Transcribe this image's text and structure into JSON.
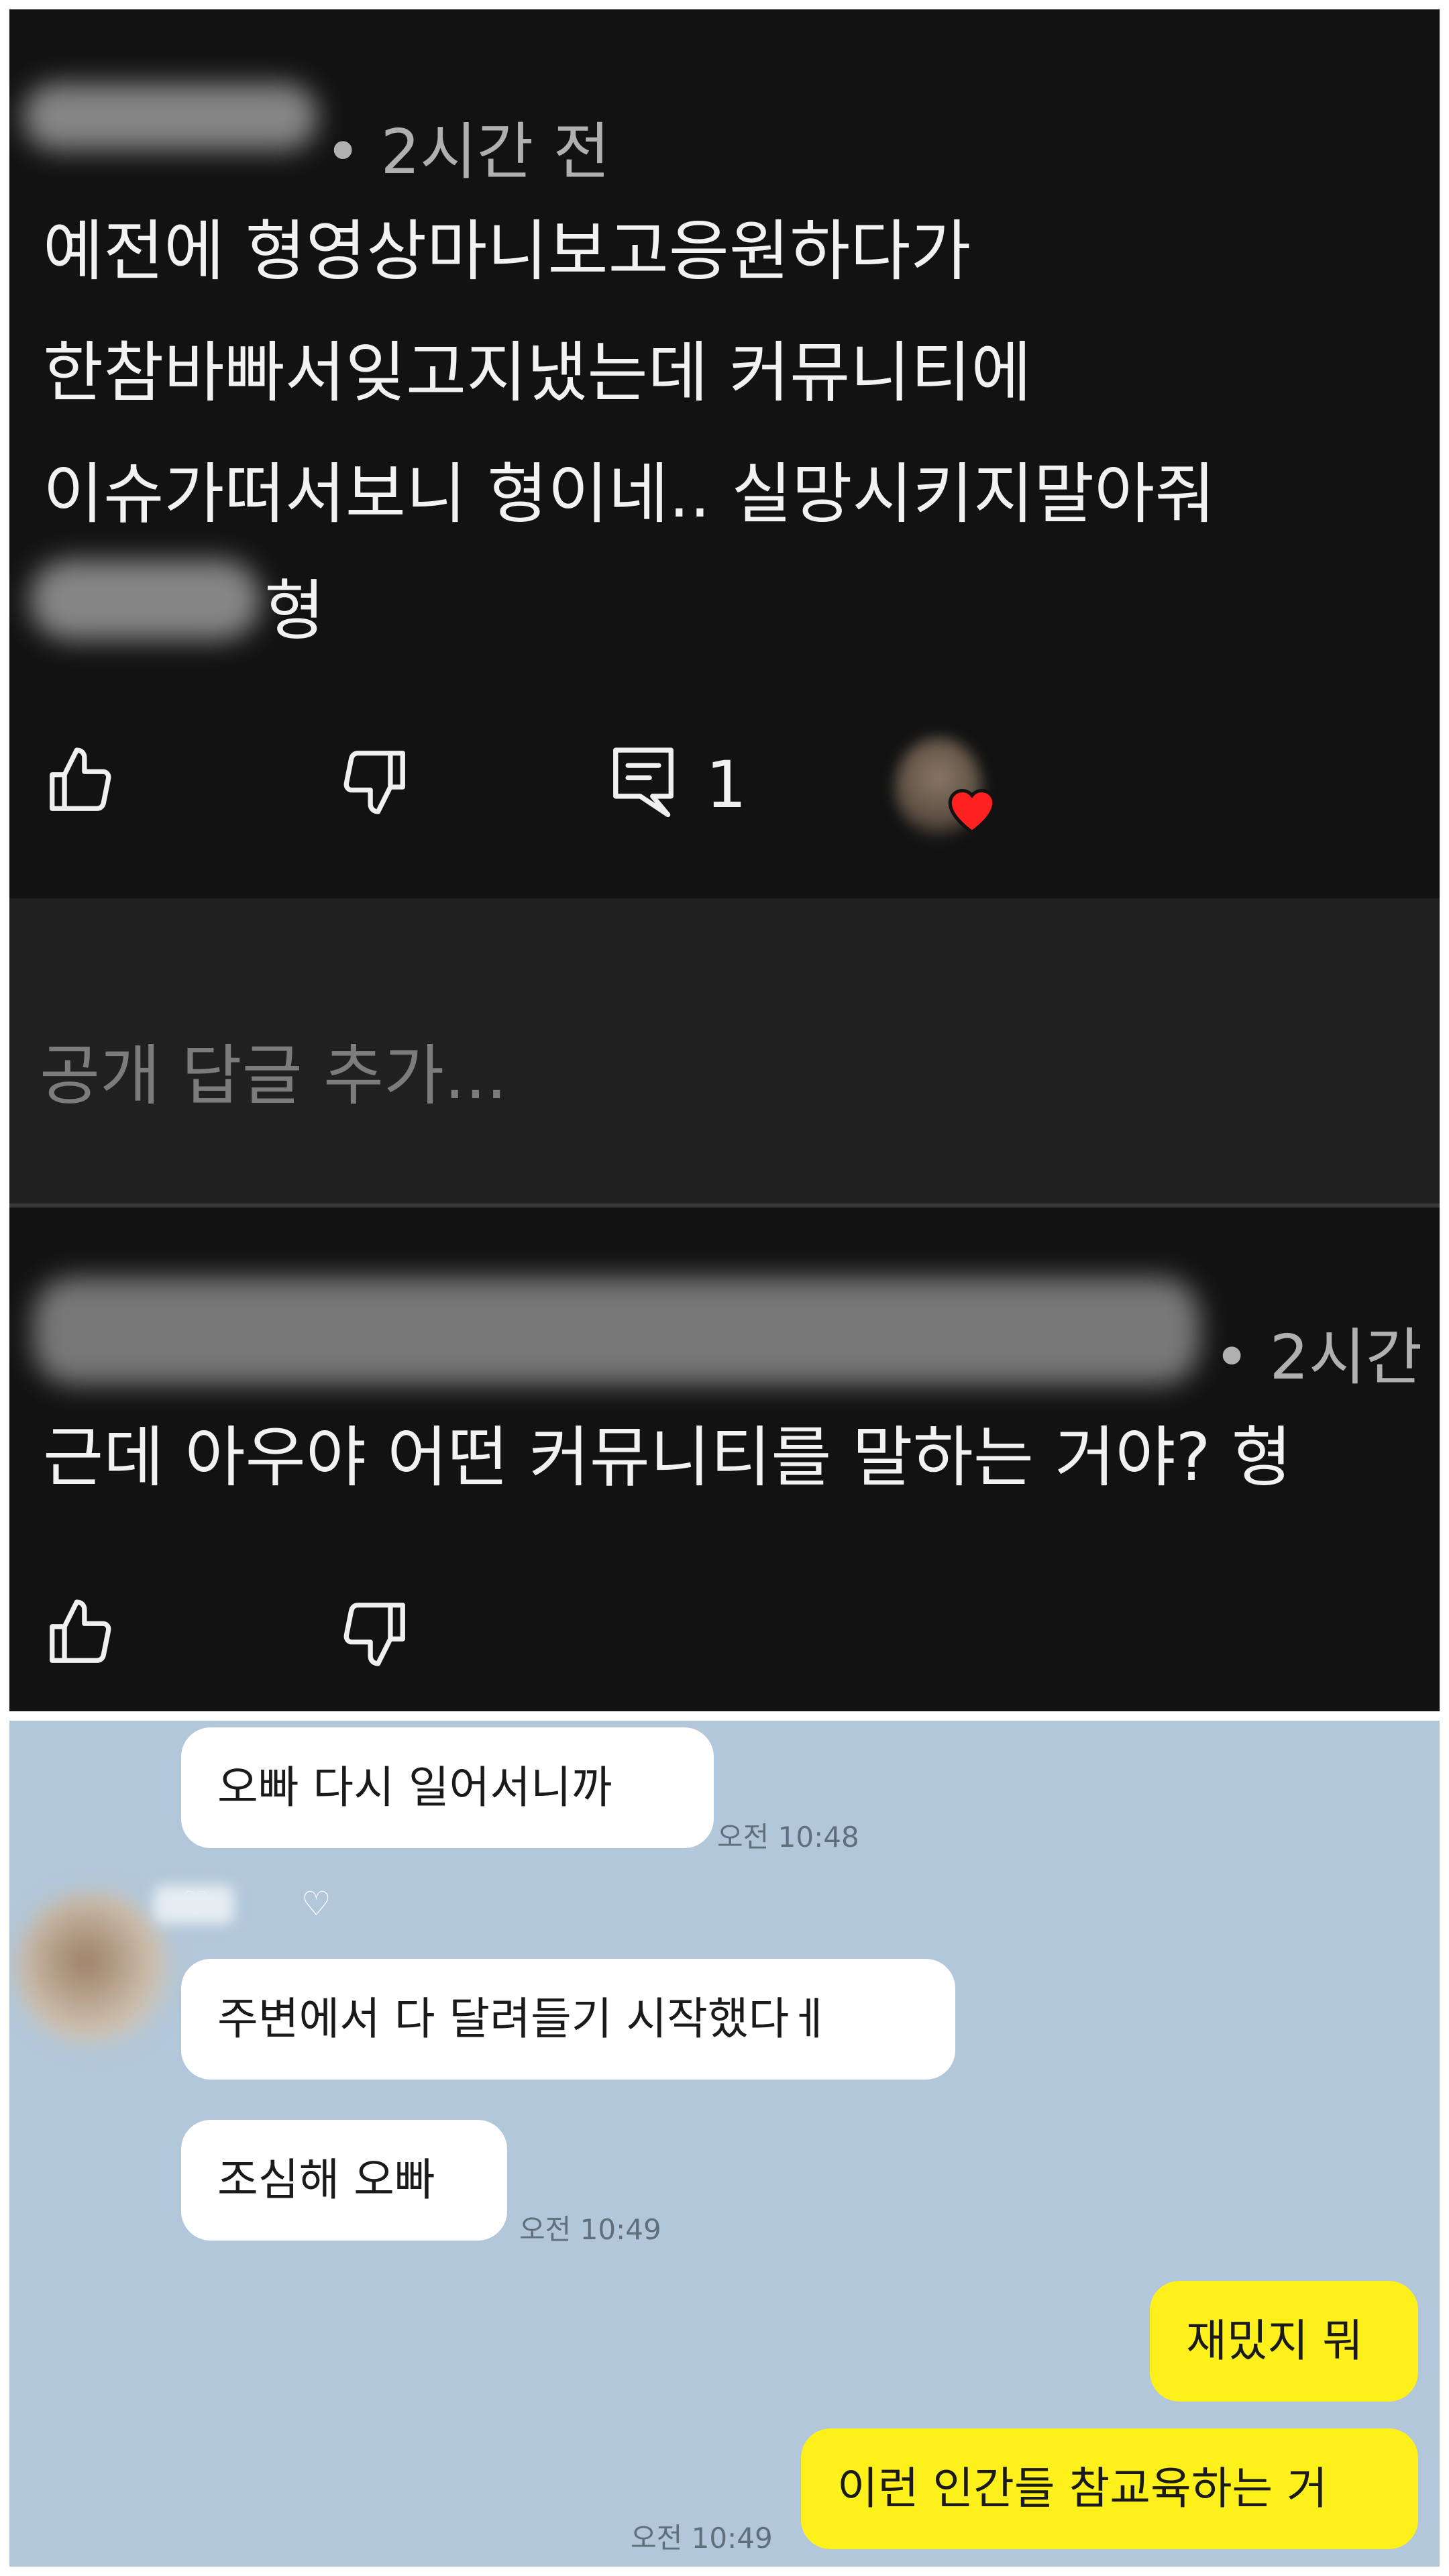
{
  "comment": {
    "time": "• 2시간 전",
    "lines": [
      "예전에 형영상마니보고응원하다가",
      "한참바빠서잊고지냈는데  커뮤니티에",
      "이슈가떠서보니 형이네..  실망시키지말아줘",
      "형"
    ],
    "reply_count": "1"
  },
  "reply_input": {
    "placeholder": "공개 답글 추가..."
  },
  "reply": {
    "time": "• 2시간",
    "text": "근데 아우야 어떤 커뮤니티를 말하는 거야? 형"
  },
  "chat": {
    "sender_hearts": [
      "♡",
      "♡"
    ],
    "messages": [
      {
        "side": "in",
        "text": "오빠 다시 일어서니까",
        "time": "오전 10:48"
      },
      {
        "side": "in",
        "text": "주변에서 다 달려들기 시작했다ㅔ"
      },
      {
        "side": "in",
        "text": "조심해 오빠",
        "time": "오전 10:49"
      },
      {
        "side": "out",
        "text": "재밌지 뭐"
      },
      {
        "side": "out",
        "text": "이런 인간들 참교육하는 거",
        "time": "오전 10:49"
      }
    ]
  },
  "colors": {
    "yt_bg": "#121212",
    "reply_bg": "#202020",
    "kakao_bg": "#b2c7d9",
    "bubble_in": "#ffffff",
    "bubble_out": "#fef01b",
    "heart": "#ff2020"
  },
  "icons": [
    "like-icon",
    "dislike-icon",
    "comment-icon",
    "creator-heart-icon"
  ]
}
